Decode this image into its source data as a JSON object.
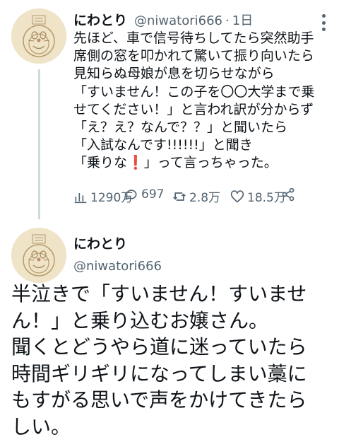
{
  "tweet1": {
    "display_name": "にわとり",
    "handle": "@niwatori666",
    "separator": "·",
    "time": "1日",
    "body": "先ほど、車で信号待ちしてたら突然助手\n席側の窓を叩かれて驚いて振り向いたら\n見知らぬ母娘が息を切らせながら\n「すいません！この子を〇〇大学まで乗\nせてください！」と言われ訳が分からず\n「え？え？なんで？？」と聞いたら\n「入試なんです!!!!!!」と聞き\n「乗りな",
    "body_mark": "❗",
    "body_end": "」って言っちゃった。",
    "views": "1290万",
    "replies": "697",
    "retweets": "2.8万",
    "likes": "18.5万"
  },
  "tweet2": {
    "display_name": "にわとり",
    "handle": "@niwatori666",
    "body": "半泣きで「すいません！すいませ\nん！」と乗り込むお嬢さん。\n聞くとどうやら道に迷っていたら\n時間ギリギリになってしまい藁に\nもすがる思いで声をかけてきたら\nしい。"
  },
  "colors": {
    "text": "#0f1419",
    "secondary": "#536471",
    "thread_line": "#cfd9de",
    "red_mark": "#e0245e"
  },
  "icons": [
    "views-icon",
    "reply-icon",
    "retweet-icon",
    "like-icon",
    "share-icon",
    "more-icon"
  ]
}
